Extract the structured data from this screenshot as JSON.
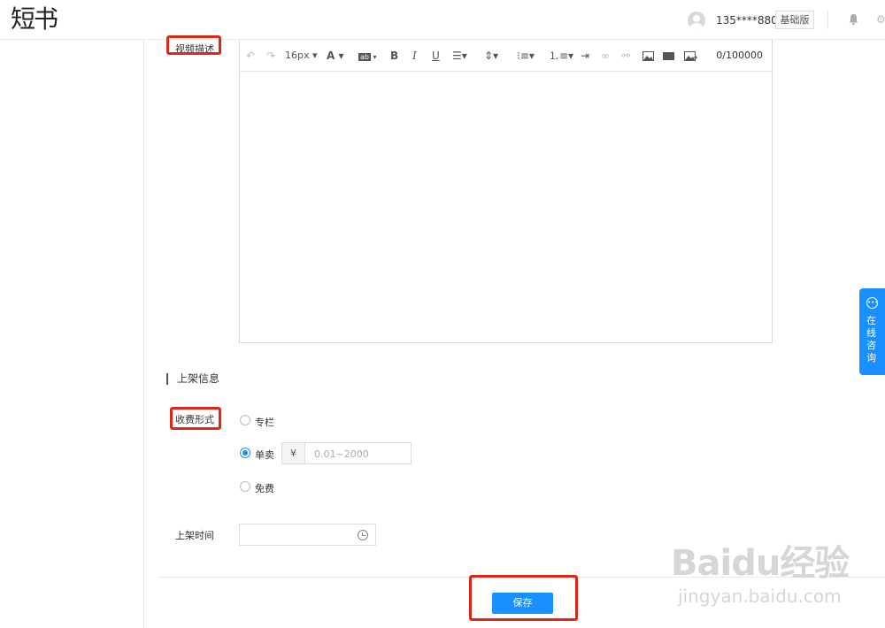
{
  "header": {
    "logo_text": "短书",
    "phone": "135****8806",
    "plan_label": "基础版",
    "bell_icon": "bell-icon",
    "settings_icon": "gear-icon"
  },
  "editor": {
    "label": "视频描述",
    "font_size": "16px",
    "char_count": "0/100000",
    "tools": [
      "undo-icon",
      "redo-icon",
      "font-size-dropdown",
      "font-color-icon",
      "bg-color-icon",
      "bold-icon",
      "italic-icon",
      "underline-icon",
      "align-icon",
      "line-height-icon",
      "bullet-list-icon",
      "numbered-list-icon",
      "indent-icon",
      "link-icon",
      "unlink-icon",
      "image-icon",
      "video-icon",
      "insert-media-icon"
    ]
  },
  "listing": {
    "section_title": "上架信息",
    "charge_label": "收费形式",
    "options": [
      {
        "label": "专栏",
        "checked": false
      },
      {
        "label": "单卖",
        "checked": true
      },
      {
        "label": "免费",
        "checked": false
      }
    ],
    "currency": "¥",
    "price_placeholder": "0.01~2000",
    "time_label": "上架时间",
    "time_value": ""
  },
  "actions": {
    "save_label": "保存"
  },
  "consult": {
    "label": "在线咨询",
    "icon": "chat-icon"
  },
  "watermark": {
    "brand": "Baidu",
    "brand_cn": "经验",
    "url": "jingyan.baidu.com"
  },
  "colors": {
    "accent": "#1a90ff",
    "highlight": "#e0251b"
  }
}
